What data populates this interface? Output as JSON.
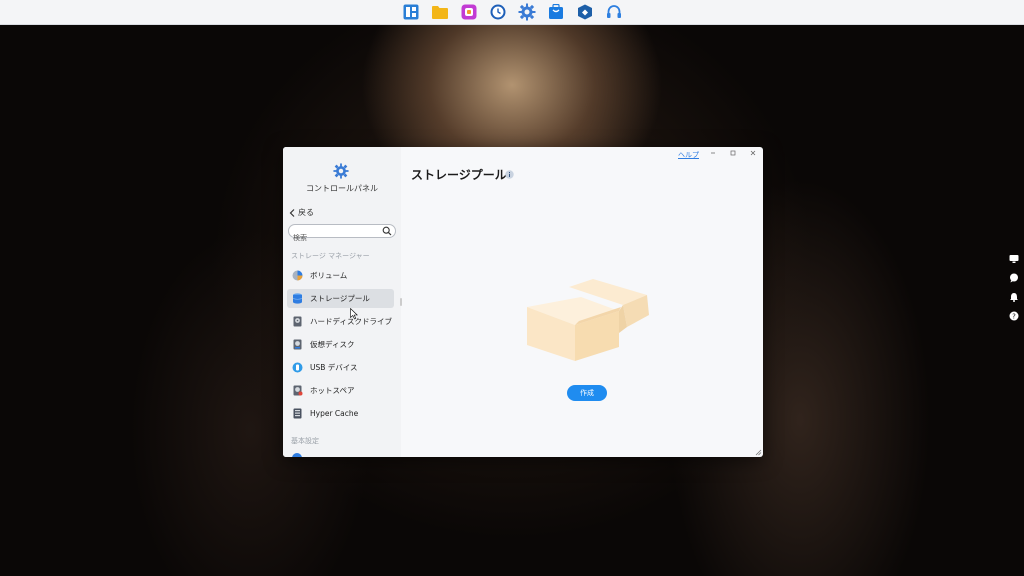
{
  "dock": {
    "apps": [
      "desktop-app-icon",
      "file-manager-icon",
      "app-center-icon",
      "clock-icon",
      "control-panel-icon",
      "store-icon",
      "security-icon",
      "support-icon"
    ]
  },
  "side_toolbar": [
    "display-icon",
    "chat-icon",
    "bell-icon",
    "help-icon"
  ],
  "window": {
    "app_title": "コントロールパネル",
    "back_label": "戻る",
    "search_placeholder": "検索",
    "help_label": "ヘルプ",
    "page_title": "ストレージプール",
    "create_label": "作成"
  },
  "sidebar": {
    "section_storage": "ストレージ マネージャー",
    "section_basic": "基本設定",
    "items": [
      {
        "label": "ボリューム",
        "icon": "volume-icon",
        "selected": false
      },
      {
        "label": "ストレージプール",
        "icon": "storage-pool-icon",
        "selected": true
      },
      {
        "label": "ハードディスクドライブ",
        "icon": "hard-disk-icon",
        "selected": false
      },
      {
        "label": "仮想ディスク",
        "icon": "virtual-disk-icon",
        "selected": false
      },
      {
        "label": "USB デバイス",
        "icon": "usb-icon",
        "selected": false
      },
      {
        "label": "ホットスペア",
        "icon": "hot-spare-icon",
        "selected": false
      },
      {
        "label": "Hyper Cache",
        "icon": "hyper-cache-icon",
        "selected": false
      }
    ]
  },
  "colors": {
    "accent": "#1f8cf0",
    "selected_bg": "#dcdfe3",
    "help_link": "#2f7de1"
  }
}
